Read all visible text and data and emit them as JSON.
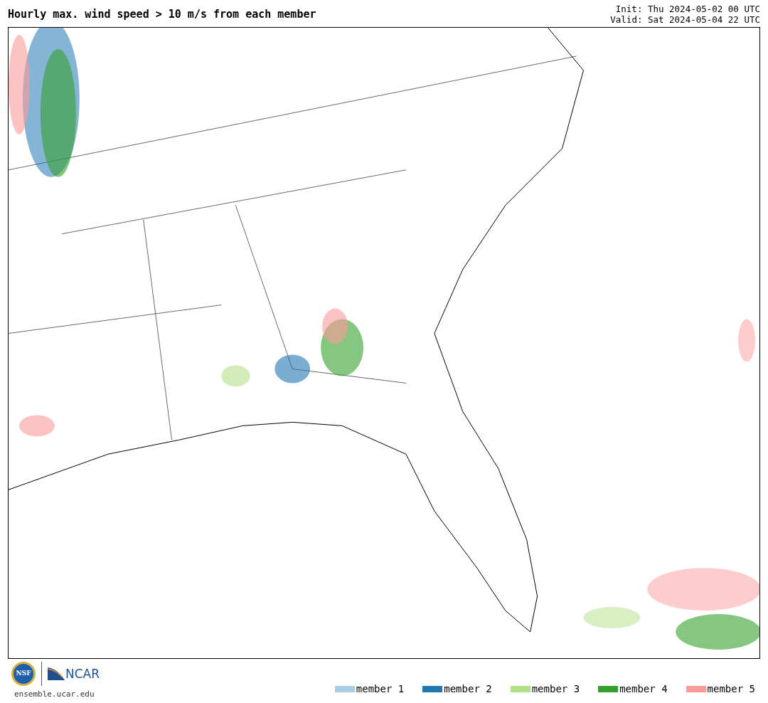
{
  "title": "Hourly max. wind speed > 10 m/s from each member",
  "run_info": [
    "Init: Thu 2024-05-02 00 UTC",
    "Valid: Sat 2024-05-04 22 UTC"
  ],
  "logos": {
    "nsf": "NSF",
    "ncar": "NCAR"
  },
  "site": "ensemble.ucar.edu",
  "legend": [
    {
      "label": "member 1",
      "color": "#a6cee3"
    },
    {
      "label": "member 2",
      "color": "#1f78b4"
    },
    {
      "label": "member 3",
      "color": "#b2df8a"
    },
    {
      "label": "member 4",
      "color": "#33a02c"
    },
    {
      "label": "member 5",
      "color": "#fb9a99"
    }
  ]
}
